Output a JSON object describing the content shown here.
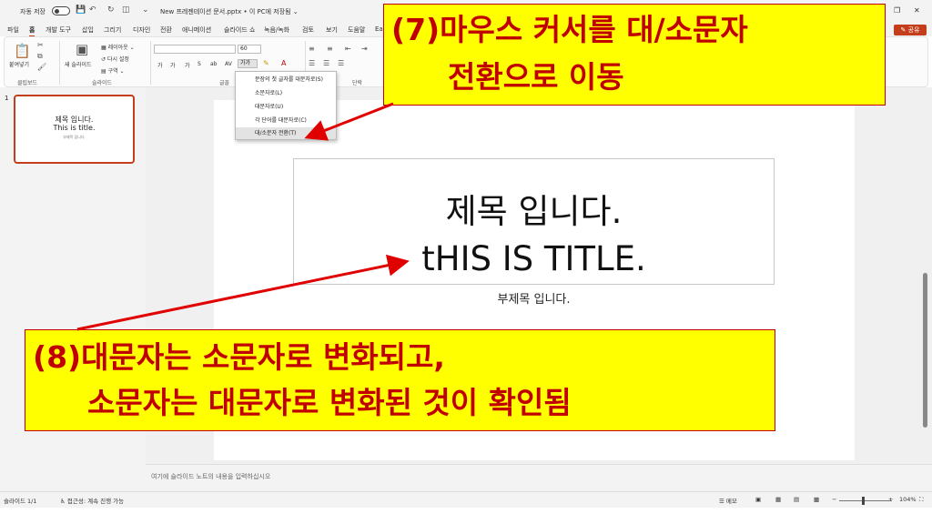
{
  "titlebar": {
    "autosave_label": "자동 저장",
    "doc_title": "New 프레젠테이션 문서.pptx • 이 PC에 저장됨 ⌄",
    "win_min": "—",
    "win_restore": "❐",
    "win_close": "✕"
  },
  "tabs": [
    {
      "label": "파일"
    },
    {
      "label": "홈"
    },
    {
      "label": "개발 도구"
    },
    {
      "label": "삽입"
    },
    {
      "label": "그리기"
    },
    {
      "label": "디자인"
    },
    {
      "label": "전환"
    },
    {
      "label": "애니메이션"
    },
    {
      "label": "슬라이드 쇼"
    },
    {
      "label": "녹음/녹화"
    },
    {
      "label": "검토"
    },
    {
      "label": "보기"
    },
    {
      "label": "도움말"
    },
    {
      "label": "Ea"
    }
  ],
  "share_label": "공유",
  "ribbon": {
    "paste_label": "붙여넣기",
    "new_slide_label": "새 슬라이드",
    "layout_label": "레이아웃",
    "reset_label": "다시 설정",
    "section_label": "구역",
    "font_size": "60",
    "change_case_label": "가가",
    "groups": {
      "clipboard": "클립보드",
      "slides": "슬라이드",
      "font": "글꼴",
      "paragraph": "단락"
    }
  },
  "dropdown": {
    "items": [
      {
        "label": "문장의 첫 글자를 대문자로(S)"
      },
      {
        "label": "소문자로(L)"
      },
      {
        "label": "대문자로(U)"
      },
      {
        "label": "각 단어를 대문자로(C)"
      },
      {
        "label": "대/소문자 전환(T)"
      }
    ]
  },
  "thumbnail": {
    "number": "1",
    "title1": "제목 입니다.",
    "title2": "This is title.",
    "subtitle": "부제목 입니다."
  },
  "slide": {
    "title_line1": "제목 입니다.",
    "title_line2": "tHIS IS TITLE.",
    "subtitle": "부제목 입니다."
  },
  "notes_placeholder": "여기에 슬라이드 노트의 내용을 입력하십시오",
  "statusbar": {
    "slide_info": "슬라이드 1/1",
    "accessibility": "접근성: 계속 진행 가능",
    "notes_label": "메모",
    "zoom": "104%"
  },
  "callouts": {
    "c7_line1": "(7)마우스 커서를 대/소문자",
    "c7_line2": "전환으로 이동",
    "c8_line1": "(8)대문자는 소문자로 변화되고,",
    "c8_line2": "소문자는 대문자로 변화된 것이 확인됨"
  },
  "colors": {
    "accent": "#c43e1c",
    "callout_bg": "#ffff00",
    "callout_text": "#c00000",
    "arrow": "#e00000"
  }
}
